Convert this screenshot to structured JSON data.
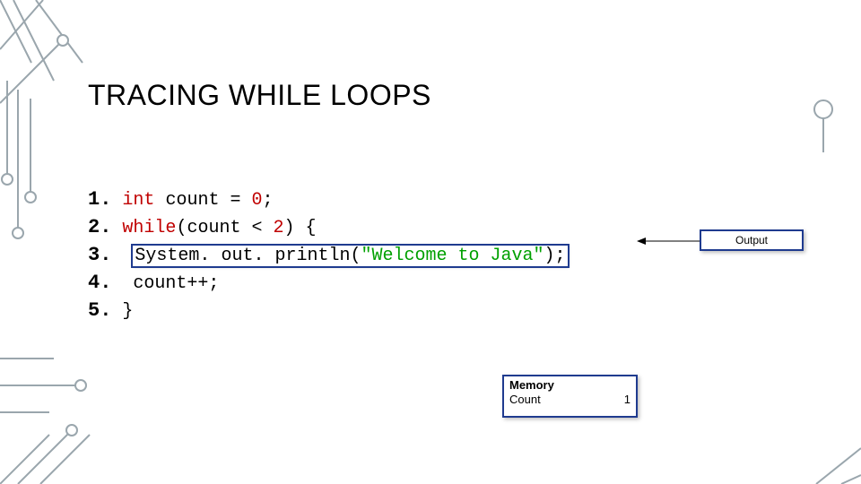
{
  "title": "TRACING WHILE LOOPS",
  "code": {
    "line1": {
      "ln": "1.",
      "kw": "int",
      "rest": " count = ",
      "zero": "0",
      "semi": ";"
    },
    "line2": {
      "ln": "2.",
      "kw": "while",
      "open": "(count < ",
      "two": "2",
      "close": ") {"
    },
    "line3": {
      "ln": "3.",
      "indent": "  ",
      "call": "System. out. println(",
      "str": "\"Welcome to Java\"",
      "end": ");"
    },
    "line4": {
      "ln": "4.",
      "indent": "  ",
      "stmt": "count++;"
    },
    "line5": {
      "ln": "5.",
      "brace": "}"
    }
  },
  "memory": {
    "title": "Memory",
    "var": "Count",
    "value": "1"
  },
  "output": {
    "label": "Output"
  }
}
